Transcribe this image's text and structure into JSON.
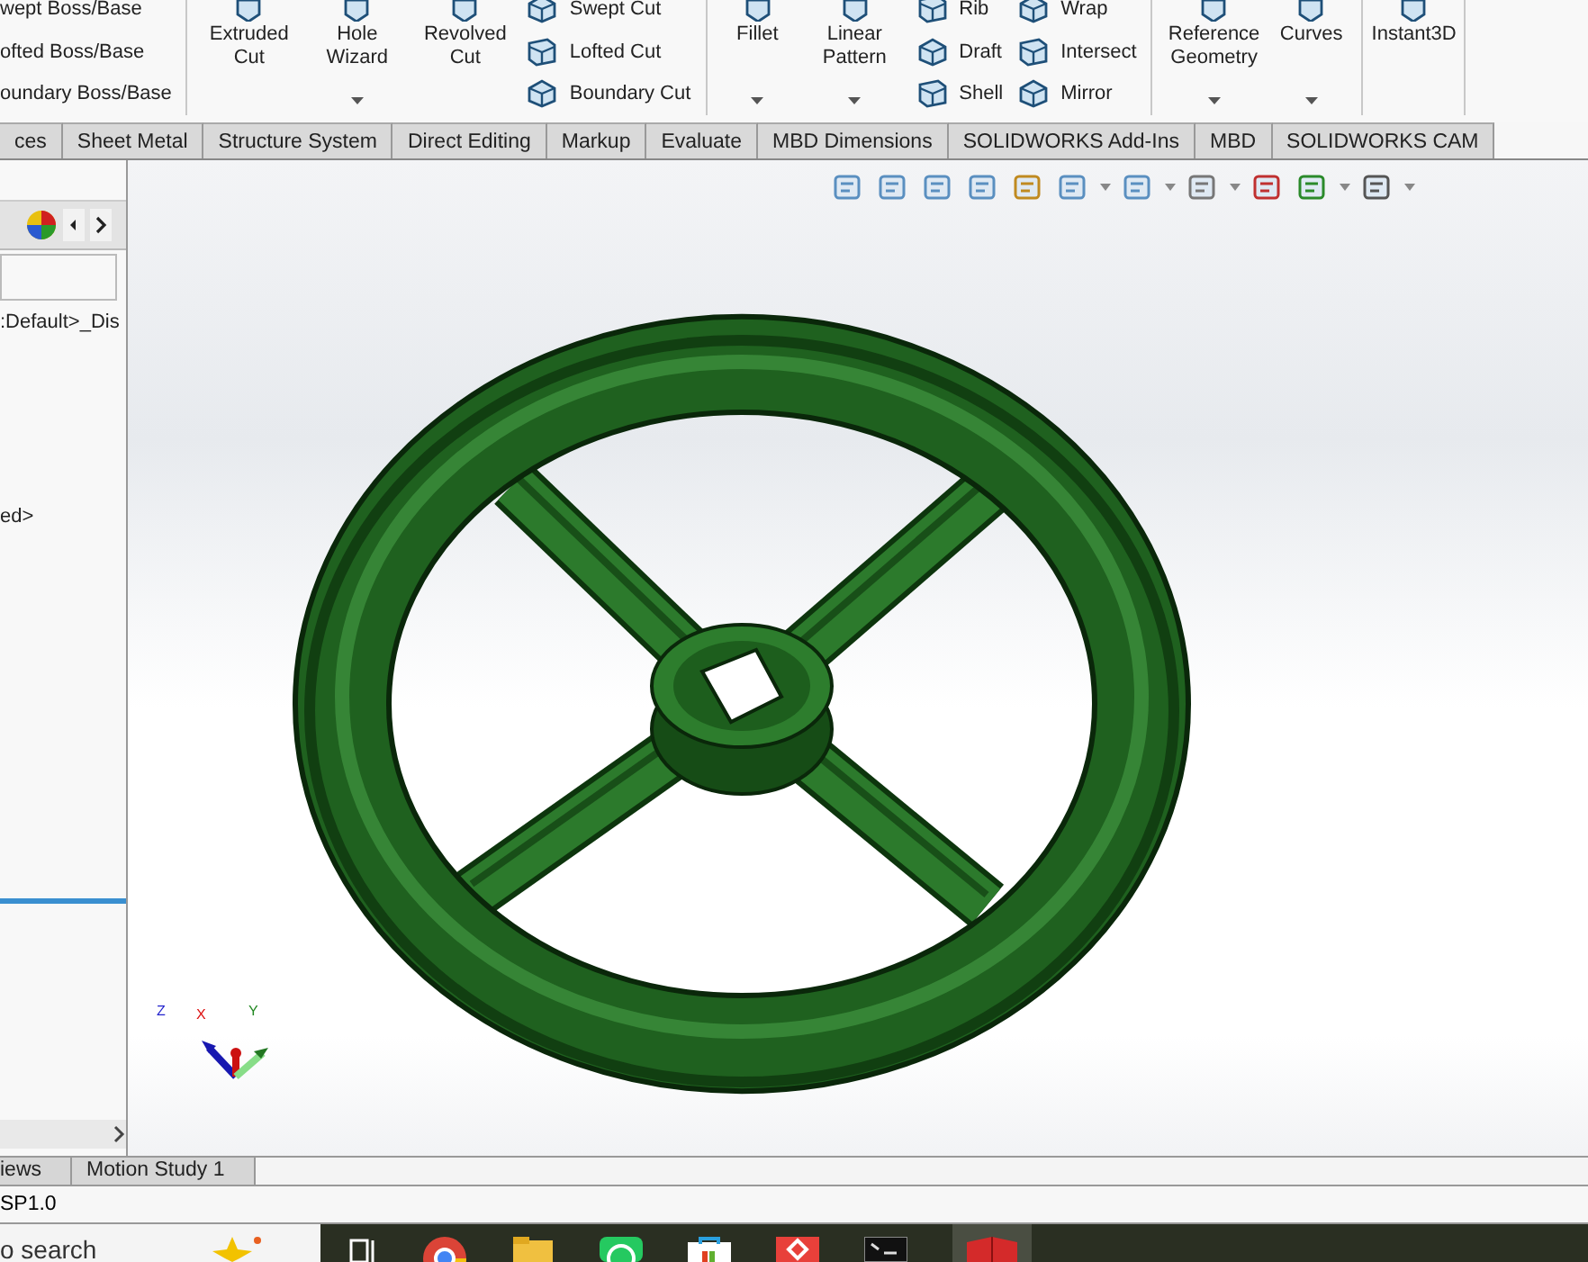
{
  "ribbon": {
    "groups": [
      {
        "columns": [
          {
            "kind": "stack",
            "items": [
              "wept Boss/Base",
              "ofted Boss/Base",
              "oundary Boss/Base"
            ]
          }
        ]
      },
      {
        "columns": [
          {
            "kind": "large",
            "label": "Extruded\nCut",
            "dropdown": false
          },
          {
            "kind": "large",
            "label": "Hole\nWizard",
            "dropdown": true
          },
          {
            "kind": "large",
            "label": "Revolved\nCut",
            "dropdown": false
          },
          {
            "kind": "stack",
            "items": [
              "Swept Cut",
              "Lofted Cut",
              "Boundary Cut"
            ]
          }
        ]
      },
      {
        "columns": [
          {
            "kind": "large",
            "label": "Fillet",
            "dropdown": true
          },
          {
            "kind": "large",
            "label": "Linear\nPattern",
            "dropdown": true
          },
          {
            "kind": "stack",
            "items": [
              "Rib",
              "Draft",
              "Shell"
            ]
          },
          {
            "kind": "stack",
            "items": [
              "Wrap",
              "Intersect",
              "Mirror"
            ]
          }
        ]
      },
      {
        "columns": [
          {
            "kind": "large",
            "label": "Reference\nGeometry",
            "dropdown": true
          },
          {
            "kind": "large",
            "label": "Curves",
            "dropdown": true
          }
        ]
      },
      {
        "columns": [
          {
            "kind": "large",
            "label": "Instant3D",
            "dropdown": false
          }
        ]
      }
    ]
  },
  "command_tabs": [
    "ces",
    "Sheet Metal",
    "Structure System",
    "Direct Editing",
    "Markup",
    "Evaluate",
    "MBD Dimensions",
    "SOLIDWORKS Add-Ins",
    "MBD",
    "SOLIDWORKS CAM"
  ],
  "feature_tree": {
    "items": [
      ":Default>_Dis",
      "ed>"
    ]
  },
  "triad": {
    "axes": [
      "Z",
      "X",
      "Y"
    ]
  },
  "bottom_tabs": [
    "iews",
    "Motion Study 1"
  ],
  "status_bar": {
    "text": "SP1.0"
  },
  "taskbar": {
    "search": "o search"
  }
}
